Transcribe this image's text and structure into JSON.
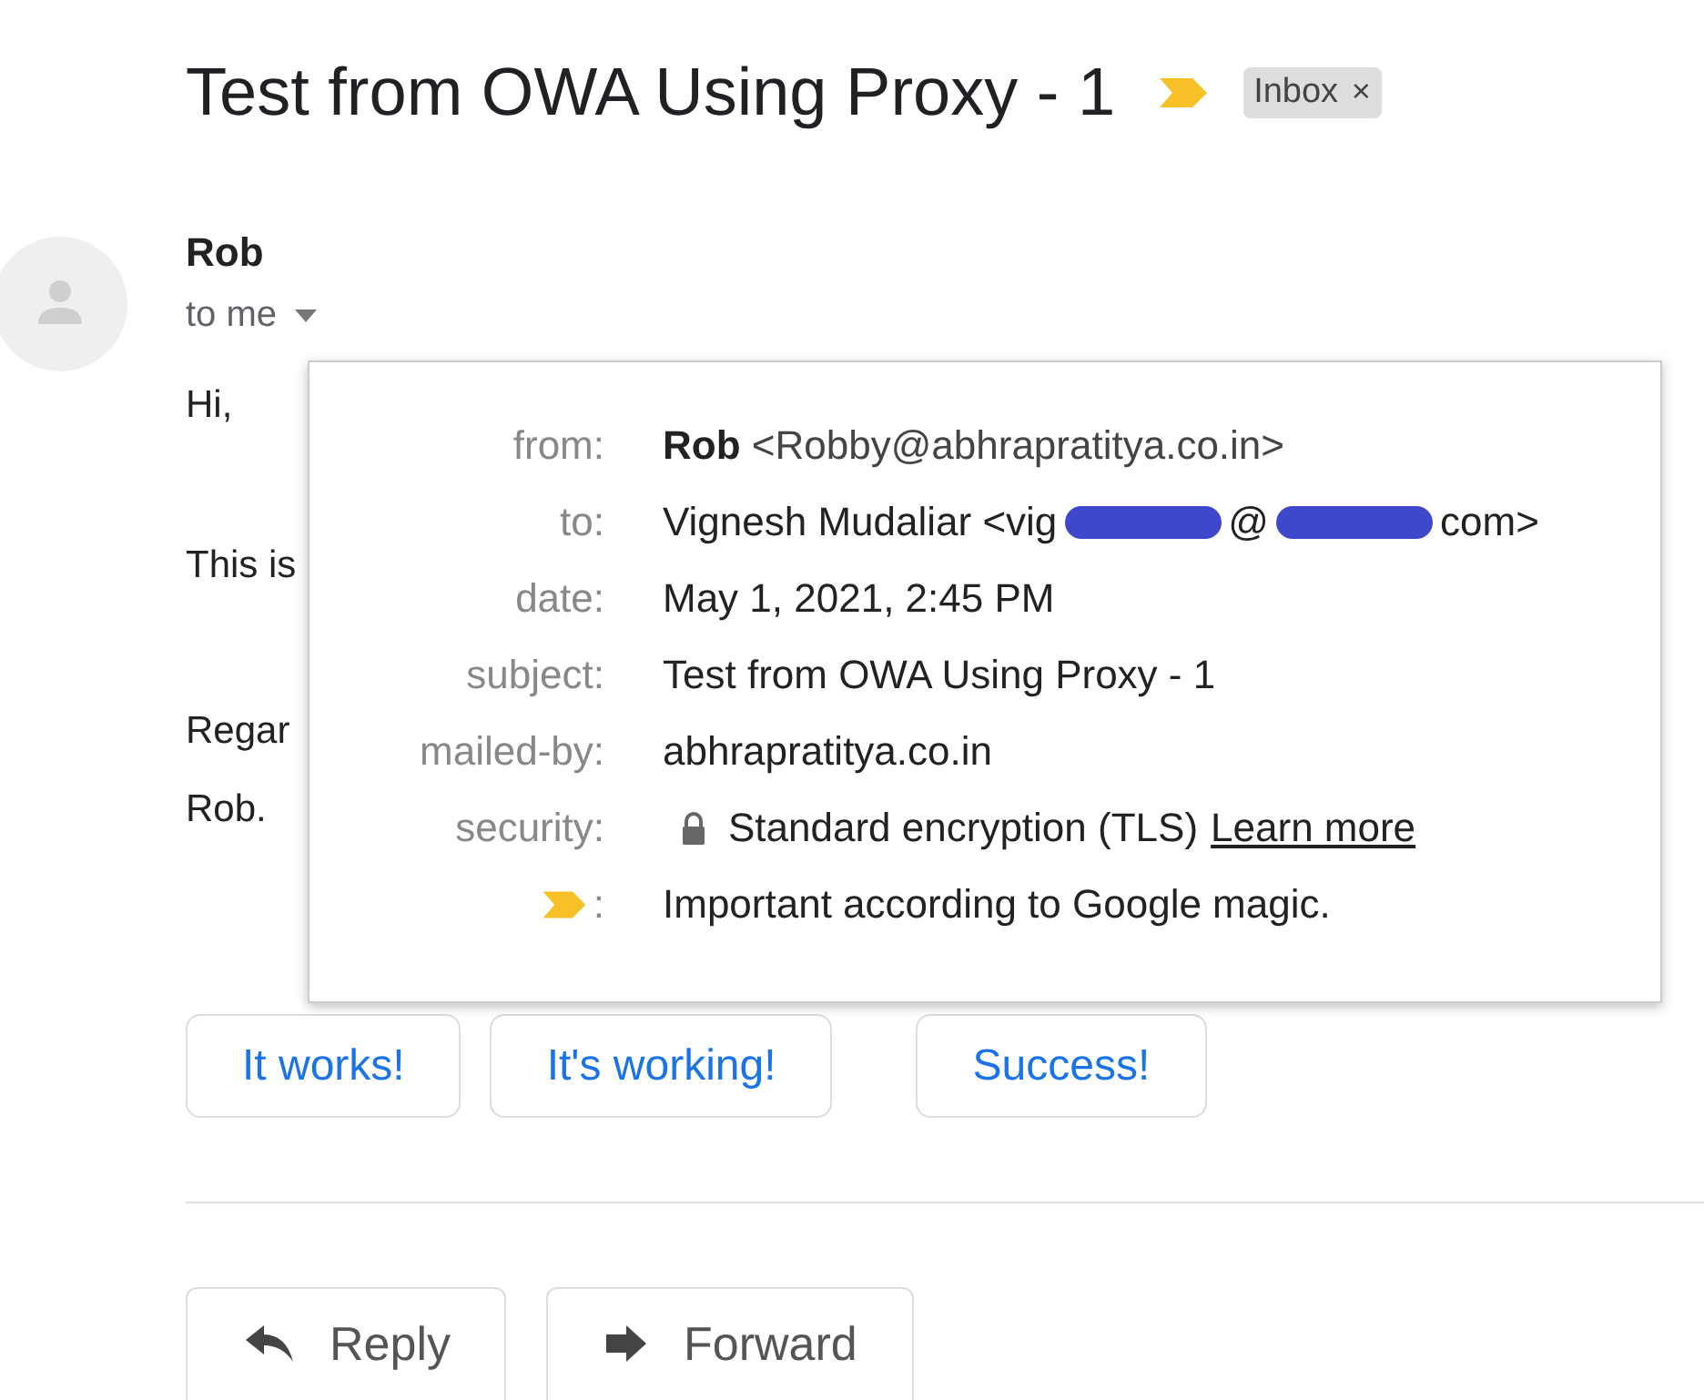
{
  "message": {
    "subject": "Test from OWA Using Proxy - 1",
    "important": true,
    "labels": [
      {
        "label": "Inbox",
        "remove": "×"
      }
    ]
  },
  "sender": {
    "name": "Rob",
    "recipient": "to me"
  },
  "body": [
    "Hi,",
    "This is",
    "Regar",
    "Rob."
  ],
  "details": [
    {
      "kind": "sender",
      "label": "from:",
      "name": "Rob",
      "address": "<Robby@abhrapratitya.co.in>"
    },
    {
      "kind": "redacted",
      "label": "to:",
      "parts": [
        "Vignesh Mudaliar <vig",
        "@",
        "com>"
      ]
    },
    {
      "kind": "text",
      "label": "date:",
      "value": "May 1, 2021, 2:45 PM"
    },
    {
      "kind": "text",
      "label": "subject:",
      "value": "Test from OWA Using Proxy - 1"
    },
    {
      "kind": "text",
      "label": "mailed-by:",
      "value": "abhrapratitya.co.in"
    },
    {
      "kind": "secure",
      "label": "security:",
      "value": "Standard encryption (TLS)",
      "link": "Learn more"
    },
    {
      "kind": "important",
      "label": ":",
      "value": "Important according to Google magic."
    }
  ],
  "smart_replies": [
    "It works!",
    "It's working!",
    "Success!"
  ],
  "actions": [
    {
      "kind": "reply",
      "label": "Reply"
    },
    {
      "kind": "forward",
      "label": "Forward"
    }
  ]
}
